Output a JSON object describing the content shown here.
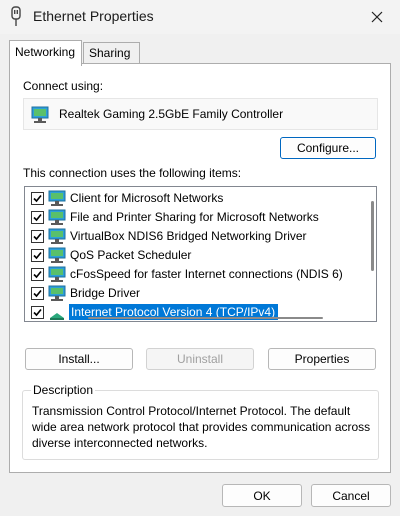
{
  "window": {
    "title": "Ethernet Properties",
    "close_icon": "close-icon",
    "title_icon": "network-adapter-icon"
  },
  "tabs": [
    {
      "label": "Networking",
      "selected": true
    },
    {
      "label": "Sharing",
      "selected": false
    }
  ],
  "connect_using": {
    "label": "Connect using:",
    "adapter": "Realtek Gaming 2.5GbE Family Controller",
    "icon": "network-adapter-icon"
  },
  "configure_button": "Configure...",
  "items_label": "This connection uses the following items:",
  "items": [
    {
      "label": "Client for Microsoft Networks",
      "checked": true,
      "icon": "network-client-icon"
    },
    {
      "label": "File and Printer Sharing for Microsoft Networks",
      "checked": true,
      "icon": "network-service-icon"
    },
    {
      "label": "VirtualBox NDIS6 Bridged Networking Driver",
      "checked": true,
      "icon": "network-service-icon"
    },
    {
      "label": "QoS Packet Scheduler",
      "checked": true,
      "icon": "network-service-icon"
    },
    {
      "label": "cFosSpeed for faster Internet connections (NDIS 6)",
      "checked": true,
      "icon": "network-service-icon"
    },
    {
      "label": "Bridge Driver",
      "checked": true,
      "icon": "network-service-icon"
    },
    {
      "label": "Internet Protocol Version 4 (TCP/IPv4)",
      "checked": true,
      "selected": true,
      "icon": "network-protocol-icon"
    }
  ],
  "buttons": {
    "install": "Install...",
    "uninstall": "Uninstall",
    "properties": "Properties"
  },
  "description": {
    "title": "Description",
    "text": "Transmission Control Protocol/Internet Protocol. The default wide area network protocol that provides communication across diverse interconnected networks."
  },
  "footer": {
    "ok": "OK",
    "cancel": "Cancel"
  },
  "colors": {
    "selection": "#0078d7",
    "focus_border": "#0067c0"
  }
}
